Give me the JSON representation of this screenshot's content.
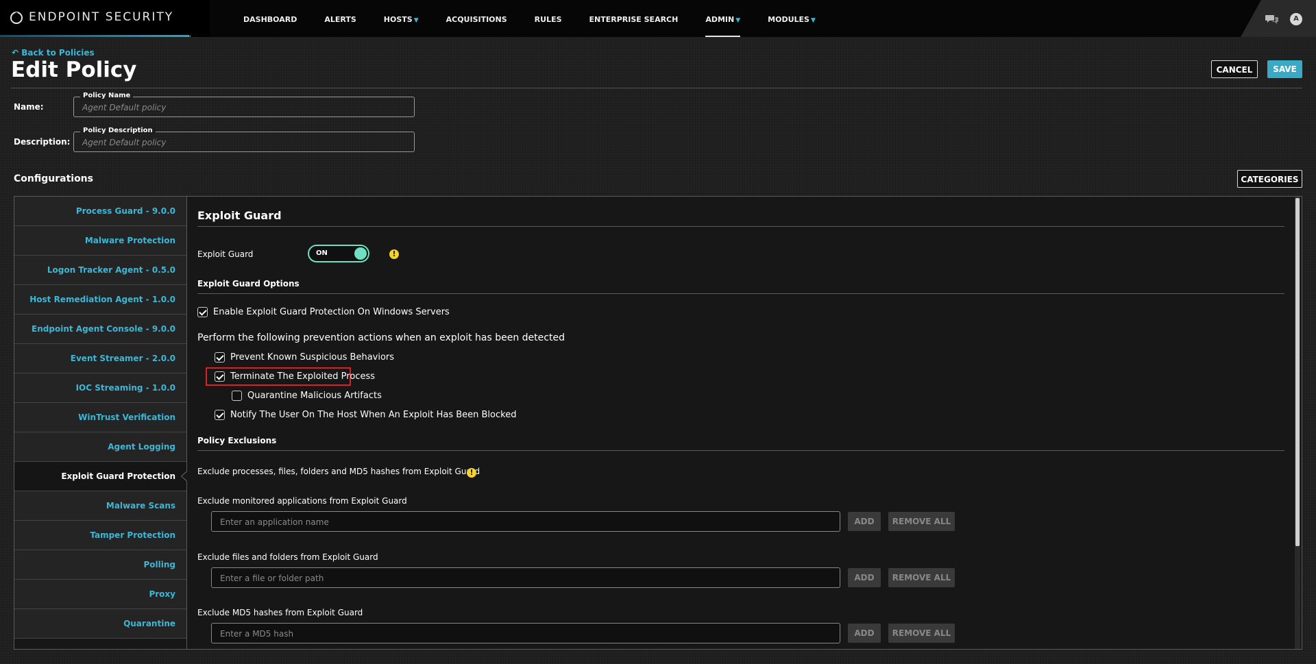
{
  "brand": {
    "name": "ENDPOINT SECURITY",
    "logo_icon": "shield-logo-icon"
  },
  "nav": {
    "items": [
      {
        "label": "DASHBOARD"
      },
      {
        "label": "ALERTS"
      },
      {
        "label": "HOSTS",
        "dropdown": true
      },
      {
        "label": "ACQUISITIONS"
      },
      {
        "label": "RULES"
      },
      {
        "label": "ENTERPRISE SEARCH"
      },
      {
        "label": "ADMIN",
        "dropdown": true,
        "active": true
      },
      {
        "label": "MODULES",
        "dropdown": true
      }
    ],
    "avatar_letter": "A"
  },
  "header": {
    "back_link": "Back to Policies",
    "title": "Edit Policy",
    "cancel_label": "CANCEL",
    "save_label": "SAVE"
  },
  "form": {
    "name_label": "Name:",
    "name_legend": "Policy Name",
    "name_placeholder": "Agent Default policy",
    "description_label": "Description:",
    "description_legend": "Policy Description",
    "description_placeholder": "Agent Default policy"
  },
  "configurations": {
    "title": "Configurations",
    "categories_label": "CATEGORIES",
    "sidebar": [
      {
        "label": "Process Guard - 9.0.0"
      },
      {
        "label": "Malware Protection"
      },
      {
        "label": "Logon Tracker Agent - 0.5.0"
      },
      {
        "label": "Host Remediation Agent - 1.0.0"
      },
      {
        "label": "Endpoint Agent Console - 9.0.0"
      },
      {
        "label": "Event Streamer - 2.0.0"
      },
      {
        "label": "IOC Streaming - 1.0.0"
      },
      {
        "label": "WinTrust Verification"
      },
      {
        "label": "Agent Logging"
      },
      {
        "label": "Exploit Guard Protection",
        "active": true
      },
      {
        "label": "Malware Scans"
      },
      {
        "label": "Tamper Protection"
      },
      {
        "label": "Polling"
      },
      {
        "label": "Proxy"
      },
      {
        "label": "Quarantine"
      }
    ]
  },
  "exploit_guard": {
    "section_title": "Exploit Guard",
    "toggle_label": "Exploit Guard",
    "toggle_state": "ON",
    "options_title": "Exploit Guard Options",
    "enable_servers": {
      "label": "Enable Exploit Guard Protection On Windows Servers",
      "checked": true
    },
    "prevention_text": "Perform the following prevention actions when an exploit has been detected",
    "actions": [
      {
        "label": "Prevent Known Suspicious Behaviors",
        "checked": true
      },
      {
        "label": "Terminate The Exploited Process",
        "checked": true
      },
      {
        "label": "Quarantine Malicious Artifacts",
        "checked": false
      },
      {
        "label": "Notify The User On The Host When An Exploit Has Been Blocked",
        "checked": true
      }
    ],
    "exclusions_title": "Policy Exclusions",
    "exclusions_desc": "Exclude processes, files, folders and MD5 hashes from Exploit Guard",
    "exclusions": [
      {
        "label": "Exclude monitored applications from Exploit Guard",
        "placeholder": "Enter an application name"
      },
      {
        "label": "Exclude files and folders from Exploit Guard",
        "placeholder": "Enter a file or folder path"
      },
      {
        "label": "Exclude MD5 hashes from Exploit Guard",
        "placeholder": "Enter a MD5 hash"
      }
    ],
    "add_label": "ADD",
    "remove_all_label": "REMOVE ALL"
  },
  "colors": {
    "accent": "#3db7d6",
    "toggle_on": "#6ee0c4",
    "warning": "#f2d22b",
    "highlight": "#e02020"
  }
}
